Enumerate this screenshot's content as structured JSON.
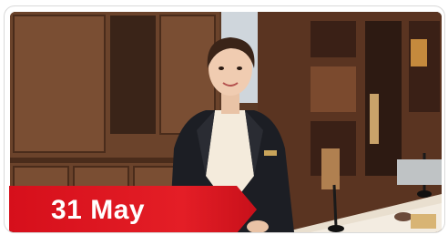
{
  "card": {
    "date_label": "31 May",
    "image_description_icon": "hotel-receptionist-photo",
    "banner_color": "#e01b24"
  }
}
